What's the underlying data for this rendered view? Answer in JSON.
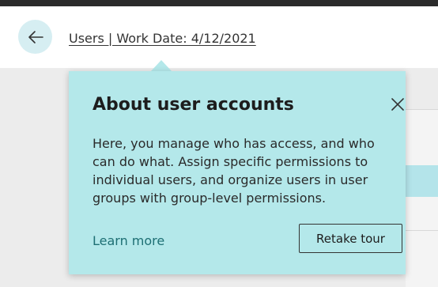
{
  "header": {
    "back_icon": "arrow-left-icon",
    "title": "Users | Work Date: 4/12/2021"
  },
  "popover": {
    "title": "About user accounts",
    "close_icon": "close-icon",
    "body": "Here, you manage who has access, and who can do what. Assign specific permissions to individual users, and organize users in user groups with group-level permissions.",
    "learn_more_label": "Learn more",
    "retake_tour_label": "Retake tour"
  },
  "colors": {
    "header_bg": "#ffffff",
    "content_bg": "#ececec",
    "popover_bg": "#b4e8ea",
    "link": "#1e6f74",
    "back_button_bg": "#d6eef2",
    "highlight_row": "#b4e4ea"
  }
}
